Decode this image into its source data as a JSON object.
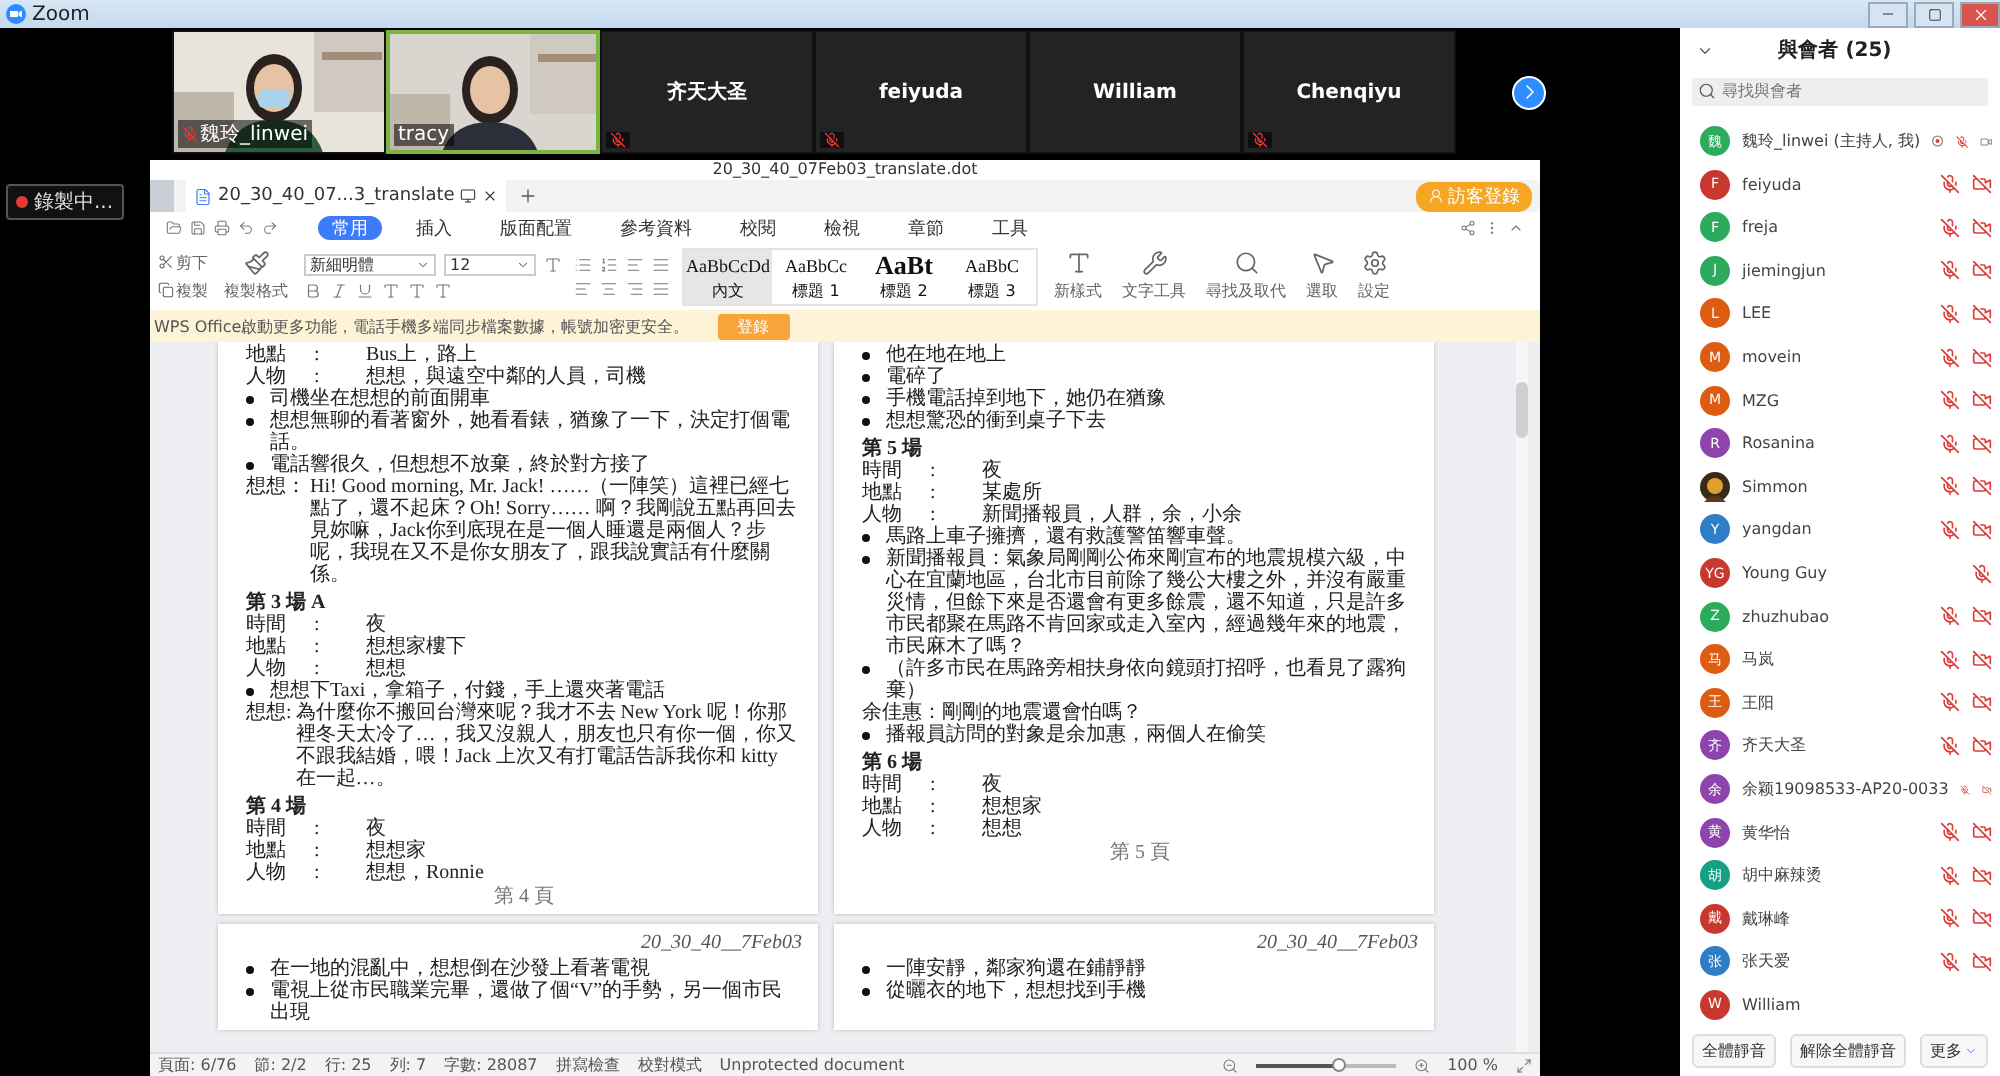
{
  "app_title": "Zoom",
  "recording_badge": "錄製中...",
  "video_tiles": [
    {
      "kind": "picture",
      "name": "魏玲_linwei",
      "mic_muted": true,
      "speaking": false
    },
    {
      "kind": "picture",
      "name": "tracy",
      "mic_muted": false,
      "speaking": true
    },
    {
      "kind": "name",
      "name": "齐天大圣",
      "mic_muted": true,
      "speaking": false
    },
    {
      "kind": "name",
      "name": "feiyuda",
      "mic_muted": true,
      "speaking": false
    },
    {
      "kind": "name",
      "name": "William",
      "mic_muted": false,
      "speaking": false
    },
    {
      "kind": "name",
      "name": "Chenqiyu",
      "mic_muted": true,
      "speaking": false
    }
  ],
  "editor": {
    "window_title": "20_30_40_07Feb03_translate.dot",
    "doc_tab": "20_30_40_07...3_translate",
    "login_button": "訪客登錄",
    "menu": [
      {
        "label": "常用",
        "selected": true
      },
      {
        "label": "插入",
        "selected": false
      },
      {
        "label": "版面配置",
        "selected": false
      },
      {
        "label": "參考資料",
        "selected": false
      },
      {
        "label": "校閱",
        "selected": false
      },
      {
        "label": "檢視",
        "selected": false
      },
      {
        "label": "章節",
        "selected": false
      },
      {
        "label": "工具",
        "selected": false
      }
    ],
    "clipboard": [
      "剪下",
      "複製",
      "複製格式"
    ],
    "font_name": "新細明體",
    "font_size": "12",
    "styles": [
      {
        "sample": "AaBbCcDd",
        "label": "內文",
        "selected": true
      },
      {
        "sample": "AaBbCc",
        "label": "標題 1",
        "selected": false
      },
      {
        "sample": "AaBt",
        "label": "標題 2",
        "selected": false
      },
      {
        "sample": "AaBbC",
        "label": "標題 3",
        "selected": false
      }
    ],
    "tools": [
      "新樣式",
      "文字工具",
      "尋找及取代",
      "選取",
      "設定"
    ],
    "notice": "WPS Office啟動更多功能，電話手機多端同步檔案數據，帳號加密更安全。",
    "notice_button": "登錄",
    "pages": [
      {
        "items": [
          {
            "kind": "info",
            "label": "地點",
            "sep": ":",
            "value": "Bus上，路上"
          },
          {
            "kind": "info",
            "label": "人物",
            "sep": ":",
            "value": "想想，與遠空中鄰的人員，司機"
          },
          {
            "kind": "bullet",
            "text": "司機坐在想想的前面開車"
          },
          {
            "kind": "bullet",
            "text": "想想無聊的看著窗外，她看看錶，猶豫了一下，決定打個電話。"
          },
          {
            "kind": "bullet",
            "text": "電話響很久，但想想不放棄，終於對方接了"
          },
          {
            "kind": "dialogue",
            "speaker": "想想：",
            "text": "Hi! Good morning, Mr. Jack! ……（一陣笑）這裡已經七點了，還不起床？Oh! Sorry…… 啊？我剛說五點再回去見妳嘛，Jack你到底現在是一個人睡還是兩個人？步呢，我現在又不是你女朋友了，跟我說實話有什麼關係。"
          },
          {
            "kind": "heading",
            "text": "第 3 場 A"
          },
          {
            "kind": "info",
            "label": "時間",
            "sep": ":",
            "value": "夜"
          },
          {
            "kind": "info",
            "label": "地點",
            "sep": ":",
            "value": "想想家樓下"
          },
          {
            "kind": "info",
            "label": "人物",
            "sep": ":",
            "value": "想想"
          },
          {
            "kind": "bullet",
            "text": "想想下Taxi，拿箱子，付錢，手上還夾著電話"
          },
          {
            "kind": "dialogue",
            "speaker": "想想:",
            "text": "為什麼你不搬回台灣來呢？我才不去 New York 呢！你那裡冬天太冷了…，我又沒親人，朋友也只有你一個，你又不跟我結婚，喂！Jack 上次又有打電話告訴我你和 kitty 在一起…。"
          },
          {
            "kind": "heading",
            "text": "第 4 場"
          },
          {
            "kind": "info",
            "label": "時間",
            "sep": ":",
            "value": "夜"
          },
          {
            "kind": "info",
            "label": "地點",
            "sep": ":",
            "value": "想想家"
          },
          {
            "kind": "info",
            "label": "人物",
            "sep": ":",
            "value": "想想，Ronnie"
          },
          {
            "kind": "footer",
            "text": "第 4 頁"
          }
        ]
      },
      {
        "items": [
          {
            "kind": "bullet",
            "text": "他在地在地上"
          },
          {
            "kind": "bullet",
            "text": "電碎了"
          },
          {
            "kind": "bullet",
            "text": "手機電話掉到地下，她仍在猶豫"
          },
          {
            "kind": "bullet",
            "text": "想想驚恐的衝到桌子下去"
          },
          {
            "kind": "heading",
            "text": "第 5 場"
          },
          {
            "kind": "info",
            "label": "時間",
            "sep": ":",
            "value": "夜"
          },
          {
            "kind": "info",
            "label": "地點",
            "sep": ":",
            "value": "某處所"
          },
          {
            "kind": "info",
            "label": "人物",
            "sep": ":",
            "value": "新聞播報員，人群，余，小余"
          },
          {
            "kind": "bullet",
            "text": "馬路上車子擁擠，還有救護警笛響車聲。"
          },
          {
            "kind": "bullet",
            "text": "新聞播報員：氣象局剛剛公佈來剛宣布的地震規模六級，中心在宜蘭地區，台北市目前除了幾公大樓之外，并沒有嚴重災情，但餘下來是否還會有更多餘震，還不知道，只是許多市民都聚在馬路不肯回家或走入室內，經過幾年來的地震，市民麻木了嗎？"
          },
          {
            "kind": "bullet",
            "text": "（許多市民在馬路旁相扶身依向鏡頭打招呼，也看見了露狗棄）"
          },
          {
            "kind": "para",
            "text": "余佳惠：剛剛的地震還會怕嗎？"
          },
          {
            "kind": "bullet",
            "text": "播報員訪問的對象是余加惠，兩個人在偷笑"
          },
          {
            "kind": "heading",
            "text": "第 6 場"
          },
          {
            "kind": "info",
            "label": "時間",
            "sep": ":",
            "value": "夜"
          },
          {
            "kind": "info",
            "label": "地點",
            "sep": ":",
            "value": "想想家"
          },
          {
            "kind": "info",
            "label": "人物",
            "sep": ":",
            "value": "想想"
          },
          {
            "kind": "footer",
            "text": "第 5 頁"
          }
        ]
      },
      {
        "items": [
          {
            "kind": "header",
            "text": "20_30_40__7Feb03"
          },
          {
            "kind": "bullet",
            "text": "在一地的混亂中，想想倒在沙發上看著電視"
          },
          {
            "kind": "bullet",
            "text": "電視上從市民職業完畢，還做了個“V”的手勢，另一個市民出現"
          }
        ]
      },
      {
        "items": [
          {
            "kind": "header",
            "text": "20_30_40__7Feb03"
          },
          {
            "kind": "bullet",
            "text": "一陣安靜，鄰家狗還在鋪靜靜"
          },
          {
            "kind": "bullet",
            "text": "從曬衣的地下，想想找到手機"
          }
        ]
      }
    ],
    "status": [
      "頁面: 6/76",
      "節: 2/2",
      "行: 25",
      "列: 7",
      "字數: 28087",
      "拼寫檢查",
      "校對模式",
      "Unprotected document"
    ],
    "zoom_level": "100 %",
    "zoom_slider": {
      "level": 0.6
    }
  },
  "participants": {
    "title": "與會者 (25)",
    "search": {
      "placeholder": "尋找與會者"
    },
    "list": [
      {
        "kind": "letter",
        "initial": "魏",
        "name": "魏玲_linwei (主持人, 我)",
        "color": "#2bab5b",
        "recording": true,
        "mic_muted": true,
        "has_video": true,
        "video_muted": false
      },
      {
        "kind": "letter",
        "initial": "F",
        "name": "feiyuda",
        "color": "#c8382e",
        "recording": false,
        "mic_muted": true,
        "has_video": true,
        "video_muted": true
      },
      {
        "kind": "letter",
        "initial": "F",
        "name": "freja",
        "color": "#2bab5b",
        "recording": false,
        "mic_muted": true,
        "has_video": true,
        "video_muted": true
      },
      {
        "kind": "letter",
        "initial": "J",
        "name": "jiemingjun",
        "color": "#2bab5b",
        "recording": false,
        "mic_muted": true,
        "has_video": true,
        "video_muted": true
      },
      {
        "kind": "letter",
        "initial": "L",
        "name": "LEE",
        "color": "#de5b12",
        "recording": false,
        "mic_muted": true,
        "has_video": true,
        "video_muted": true
      },
      {
        "kind": "letter",
        "initial": "M",
        "name": "movein",
        "color": "#de5b12",
        "recording": false,
        "mic_muted": true,
        "has_video": true,
        "video_muted": true
      },
      {
        "kind": "letter",
        "initial": "M",
        "name": "MZG",
        "color": "#de5b12",
        "recording": false,
        "mic_muted": true,
        "has_video": true,
        "video_muted": true
      },
      {
        "kind": "letter",
        "initial": "R",
        "name": "Rosanina",
        "color": "#8e44ad",
        "recording": false,
        "mic_muted": true,
        "has_video": true,
        "video_muted": true
      },
      {
        "kind": "picture",
        "name": "Simmon",
        "recording": false,
        "mic_muted": true,
        "has_video": true,
        "video_muted": true
      },
      {
        "kind": "letter",
        "initial": "Y",
        "name": "yangdan",
        "color": "#2d7dc7",
        "recording": false,
        "mic_muted": true,
        "has_video": true,
        "video_muted": true
      },
      {
        "kind": "letter",
        "initial": "YG",
        "name": "Young Guy",
        "color": "#c8382e",
        "recording": false,
        "mic_muted": true,
        "has_video": false
      },
      {
        "kind": "letter",
        "initial": "Z",
        "name": "zhuzhubao",
        "color": "#2bab5b",
        "recording": false,
        "mic_muted": true,
        "has_video": true,
        "video_muted": true
      },
      {
        "kind": "letter",
        "initial": "马",
        "name": "马岚",
        "color": "#de5b12",
        "recording": false,
        "mic_muted": true,
        "has_video": true,
        "video_muted": true
      },
      {
        "kind": "letter",
        "initial": "王",
        "name": "王阳",
        "color": "#de5b12",
        "recording": false,
        "mic_muted": true,
        "has_video": true,
        "video_muted": true
      },
      {
        "kind": "letter",
        "initial": "齐",
        "name": "齐天大圣",
        "color": "#8e44ad",
        "recording": false,
        "mic_muted": true,
        "has_video": true,
        "video_muted": true
      },
      {
        "kind": "letter",
        "initial": "余",
        "name": "余颖19098533-AP20-0033",
        "color": "#8e44ad",
        "recording": false,
        "mic_muted": true,
        "has_video": true,
        "video_muted": true
      },
      {
        "kind": "letter",
        "initial": "黄",
        "name": "黄华怡",
        "color": "#8e44ad",
        "recording": false,
        "mic_muted": true,
        "has_video": true,
        "video_muted": true
      },
      {
        "kind": "letter",
        "initial": "胡",
        "name": "胡中麻辣烫",
        "color": "#13a085",
        "recording": false,
        "mic_muted": true,
        "has_video": true,
        "video_muted": true
      },
      {
        "kind": "letter",
        "initial": "戴",
        "name": "戴琳峰",
        "color": "#c8382e",
        "recording": false,
        "mic_muted": true,
        "has_video": true,
        "video_muted": true
      },
      {
        "kind": "letter",
        "initial": "张",
        "name": "张天爱",
        "color": "#2d7dc7",
        "recording": false,
        "mic_muted": true,
        "has_video": true,
        "video_muted": true
      },
      {
        "kind": "letter",
        "initial": "W",
        "name": "William",
        "color": "#c8382e",
        "recording": false,
        "mic_muted": false,
        "has_video": false
      }
    ],
    "buttons": [
      "全體靜音",
      "解除全體靜音",
      "更多"
    ]
  }
}
